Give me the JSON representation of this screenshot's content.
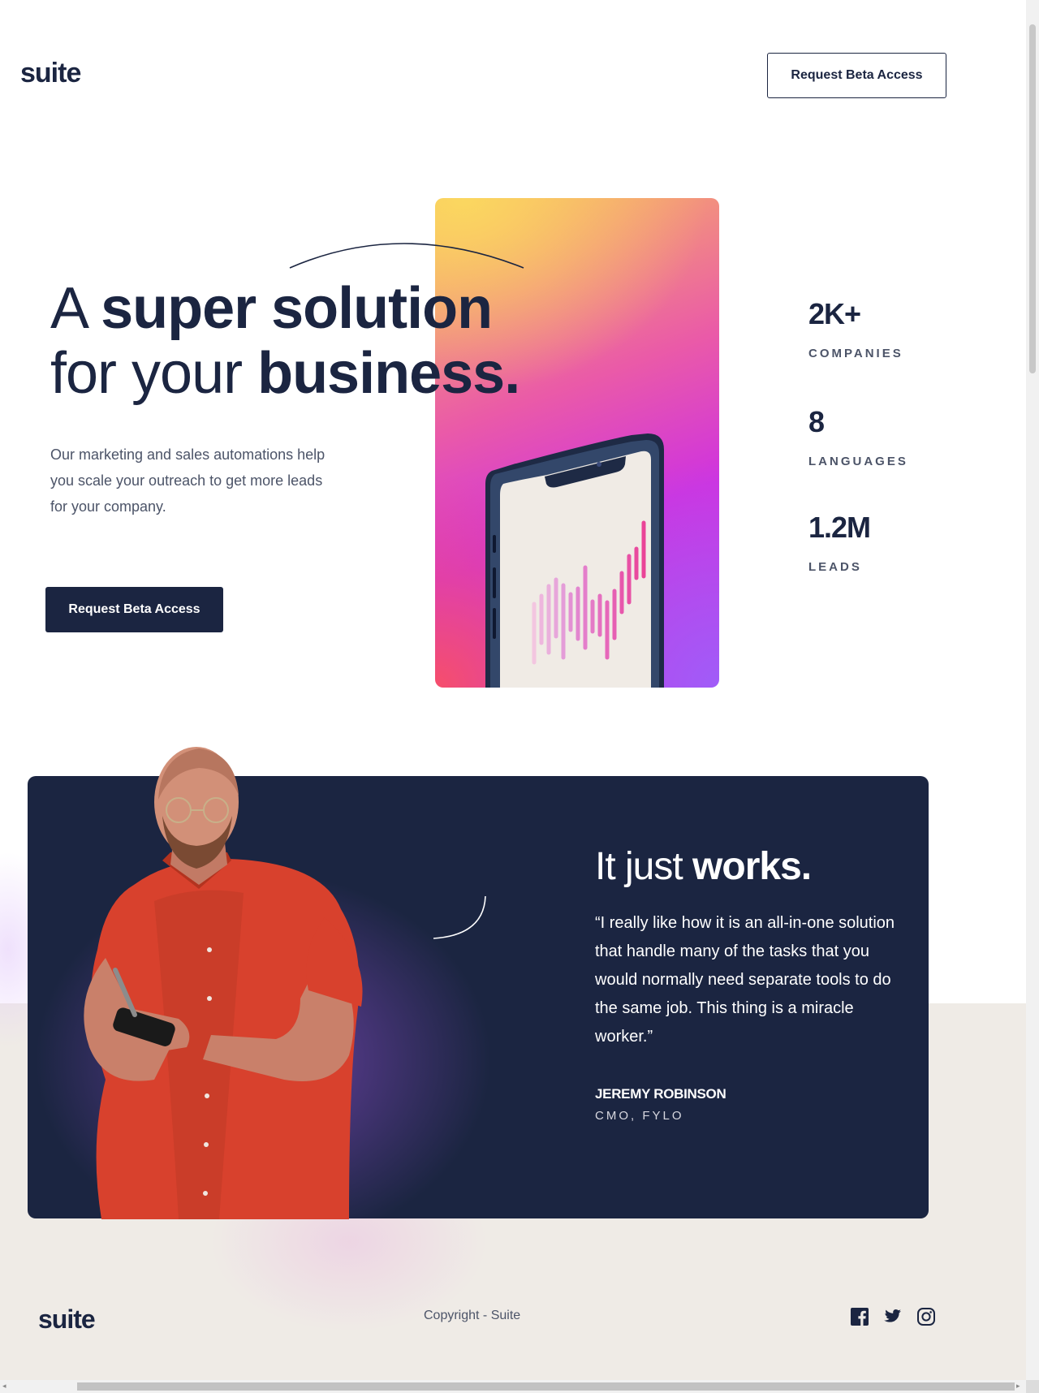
{
  "header": {
    "logo": "suite",
    "cta_label": "Request Beta Access"
  },
  "hero": {
    "title_line1_thin": "A ",
    "title_line1_bold": "super solution",
    "title_line2_thin": "for your ",
    "title_line2_bold": "business.",
    "description": "Our marketing and sales automations help you scale your outreach to get more leads for your company.",
    "cta_label": "Request Beta Access"
  },
  "stats": [
    {
      "value": "2K+",
      "label": "COMPANIES"
    },
    {
      "value": "8",
      "label": "LANGUAGES"
    },
    {
      "value": "1.2M",
      "label": "LEADS"
    }
  ],
  "testimonial": {
    "title_thin": "It just ",
    "title_bold": "works.",
    "quote": "“I really like how it is an all-in-one solution that handle many of the tasks that you would normally need separate tools to do the same job. This thing is a miracle worker.”",
    "name": "JEREMY ROBINSON",
    "role": "CMO, FYLO"
  },
  "footer": {
    "logo": "suite",
    "copyright": "Copyright - Suite"
  },
  "icons": {
    "facebook": "facebook-icon",
    "twitter": "twitter-icon",
    "instagram": "instagram-icon"
  },
  "colors": {
    "navy": "#1b2541",
    "beige": "#efebe6",
    "gray_text": "#4c5468",
    "white": "#ffffff"
  }
}
